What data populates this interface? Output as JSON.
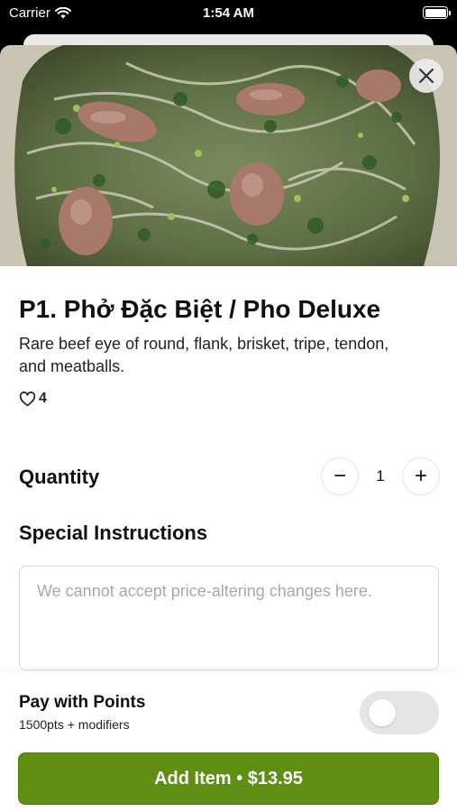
{
  "status_bar": {
    "carrier": "Carrier",
    "time": "1:54 AM"
  },
  "item": {
    "title": "P1. Phở Đặc Biệt / Pho Deluxe",
    "description": "Rare beef eye of round, flank, brisket, tripe, tendon, and meatballs.",
    "likes": "4"
  },
  "quantity": {
    "label": "Quantity",
    "value": "1",
    "minus": "−",
    "plus": "+"
  },
  "instructions": {
    "label": "Special Instructions",
    "placeholder": "We cannot accept price-altering changes here."
  },
  "points": {
    "title": "Pay with Points",
    "subtitle": "1500pts + modifiers",
    "enabled": false
  },
  "add_button": {
    "label": "Add Item • $13.95",
    "color": "#5e8f12"
  }
}
